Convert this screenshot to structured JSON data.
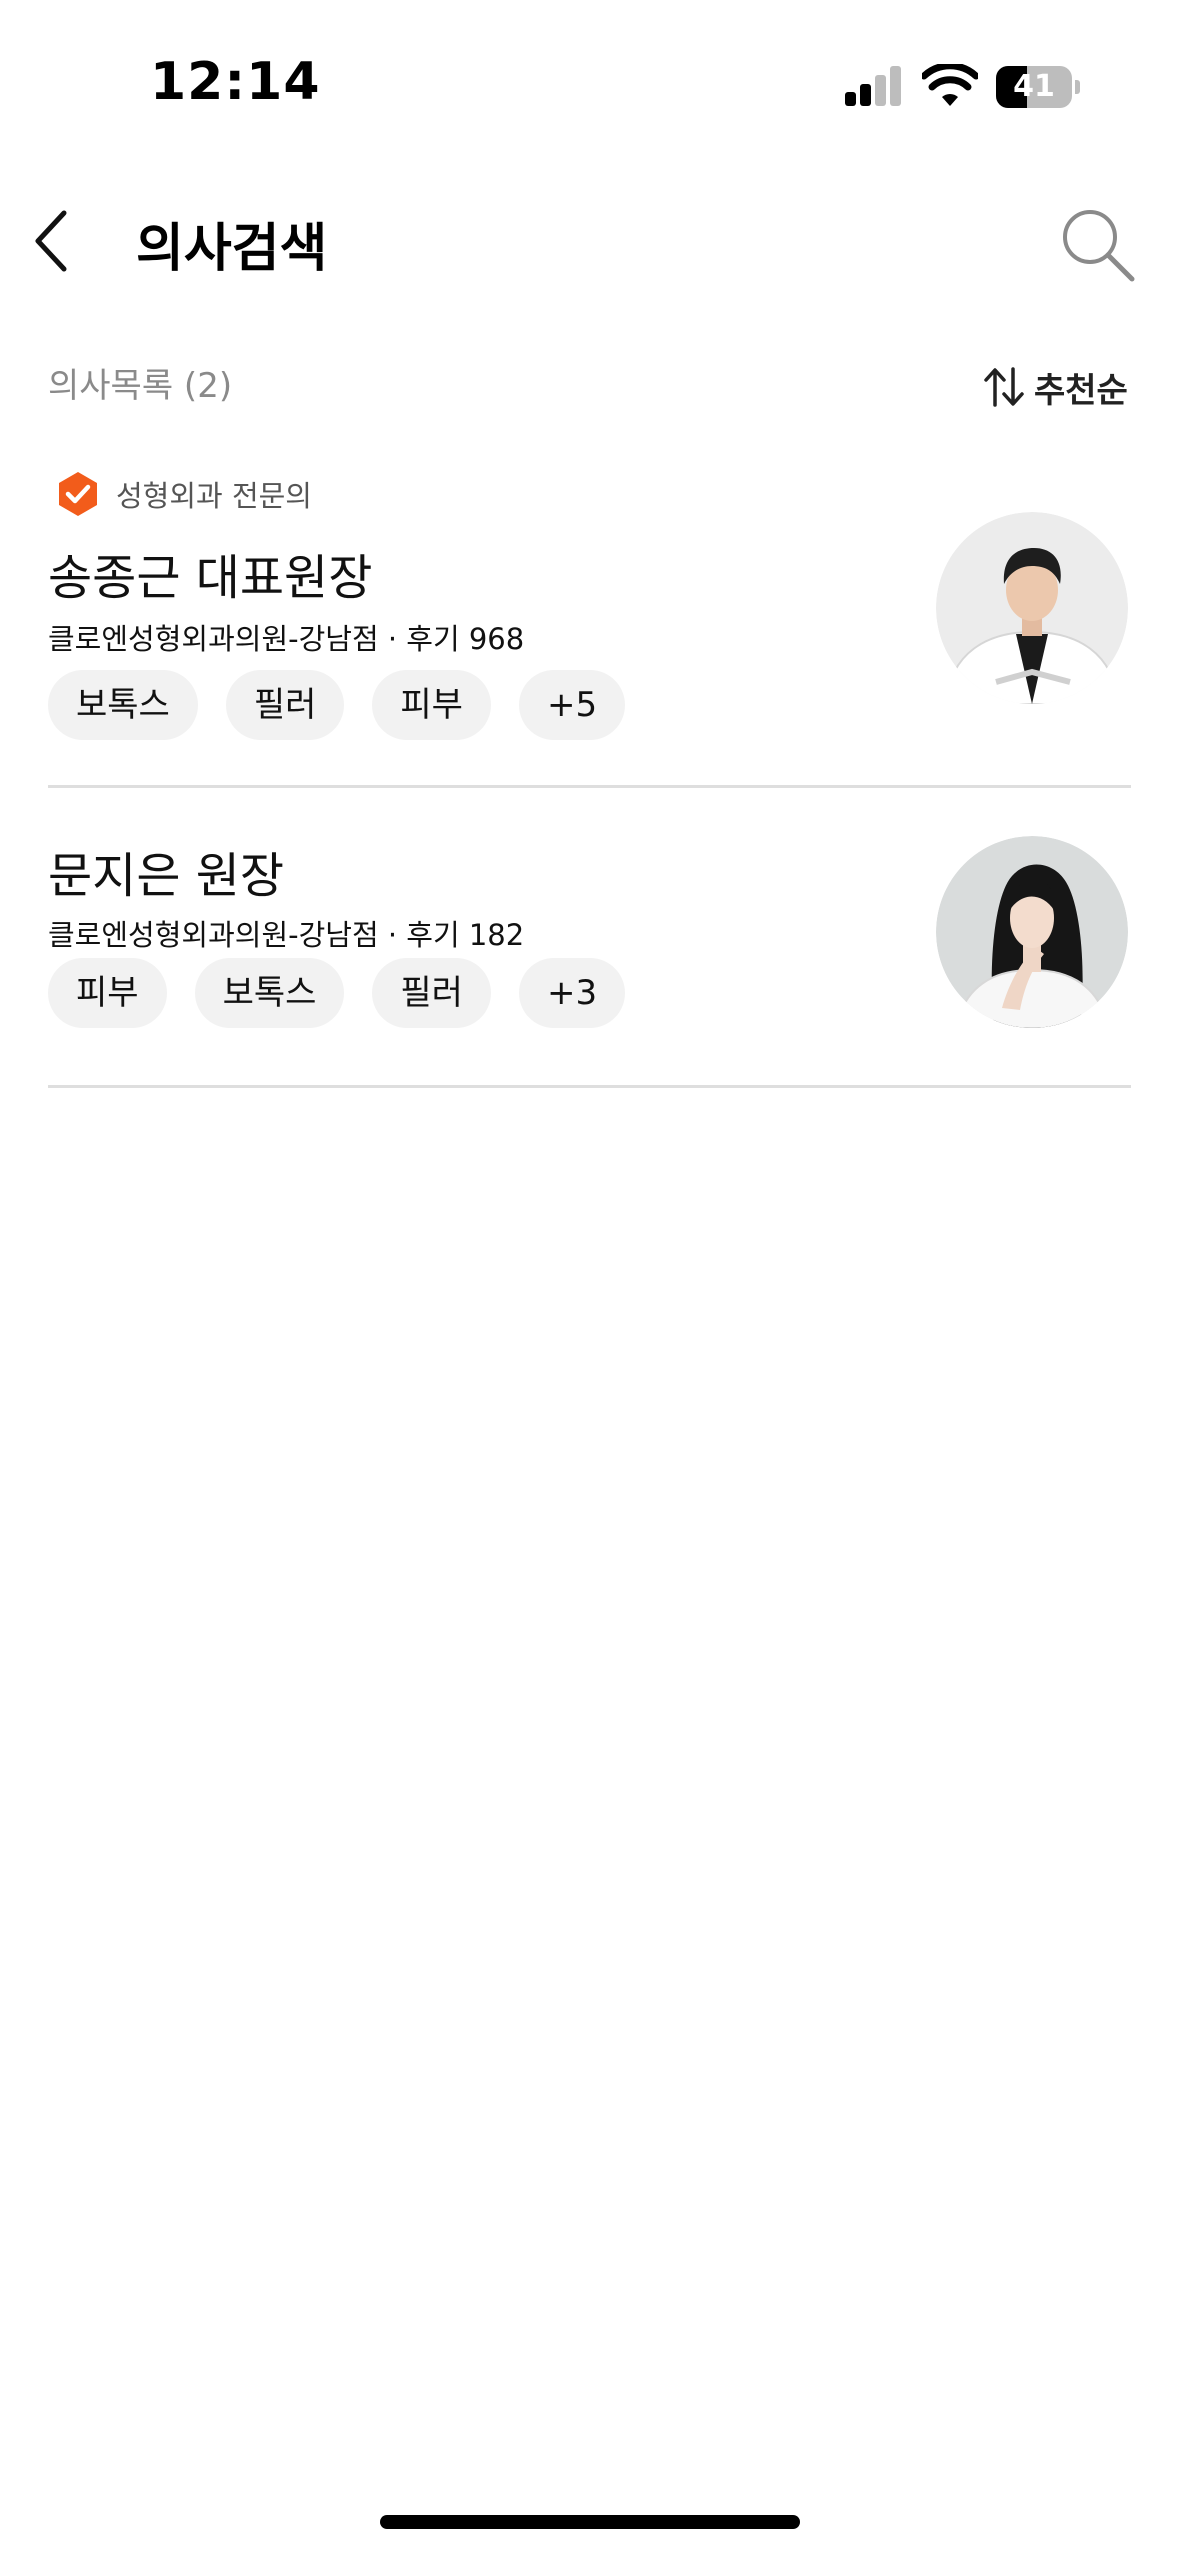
{
  "status_bar": {
    "time": "12:14",
    "battery": "41",
    "icons": [
      "cellular-signal-icon",
      "wifi-icon",
      "battery-icon"
    ]
  },
  "header": {
    "title": "의사검색",
    "back_icon": "chevron-left-icon",
    "search_icon": "search-icon"
  },
  "list": {
    "count_label": "의사목록 (2)",
    "sort_label": "추천순",
    "sort_icon": "sort-arrows-icon"
  },
  "doctors": [
    {
      "badge": "성형외과 전문의",
      "name": "송종근 대표원장",
      "meta": "클로엔성형외과의원-강남점 · 후기 968",
      "tags": [
        "보톡스",
        "필러",
        "피부",
        "+5"
      ]
    },
    {
      "name": "문지은 원장",
      "meta": "클로엔성형외과의원-강남점 · 후기 182",
      "tags": [
        "피부",
        "보톡스",
        "필러",
        "+3"
      ]
    }
  ],
  "colors": {
    "accent": "#F25C1B",
    "muted_text": "#8A8A8A",
    "tag_background": "#F2F2F2",
    "divider": "#DEDEDE"
  }
}
